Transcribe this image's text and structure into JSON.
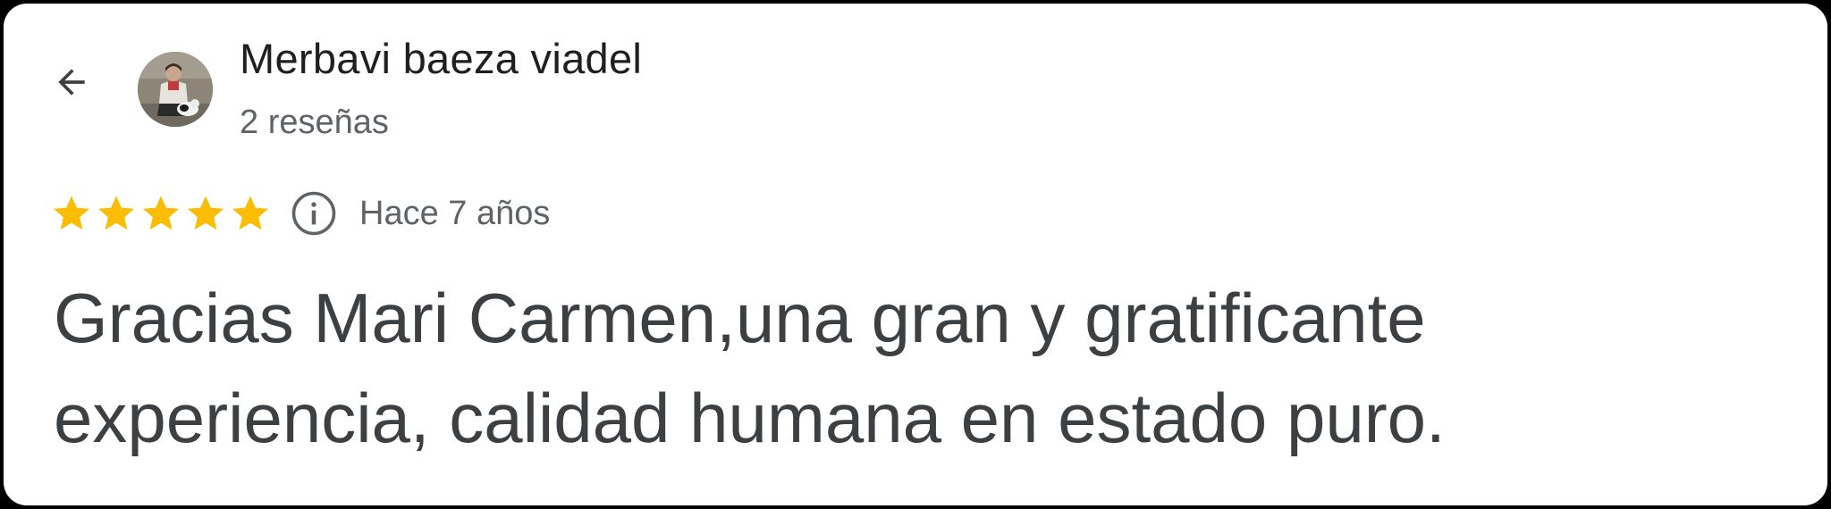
{
  "header": {
    "back_icon": "arrow-left-icon",
    "reviewer_name": "Merbavi baeza viadel",
    "review_count": "2 reseñas"
  },
  "review": {
    "rating": 5,
    "max_rating": 5,
    "star_color": "#fbbc04",
    "info_icon": "info-circle-icon",
    "date": "Hace 7 años",
    "text": "Gracias Mari Carmen,una gran y gratificante experiencia, calidad humana en estado puro."
  }
}
